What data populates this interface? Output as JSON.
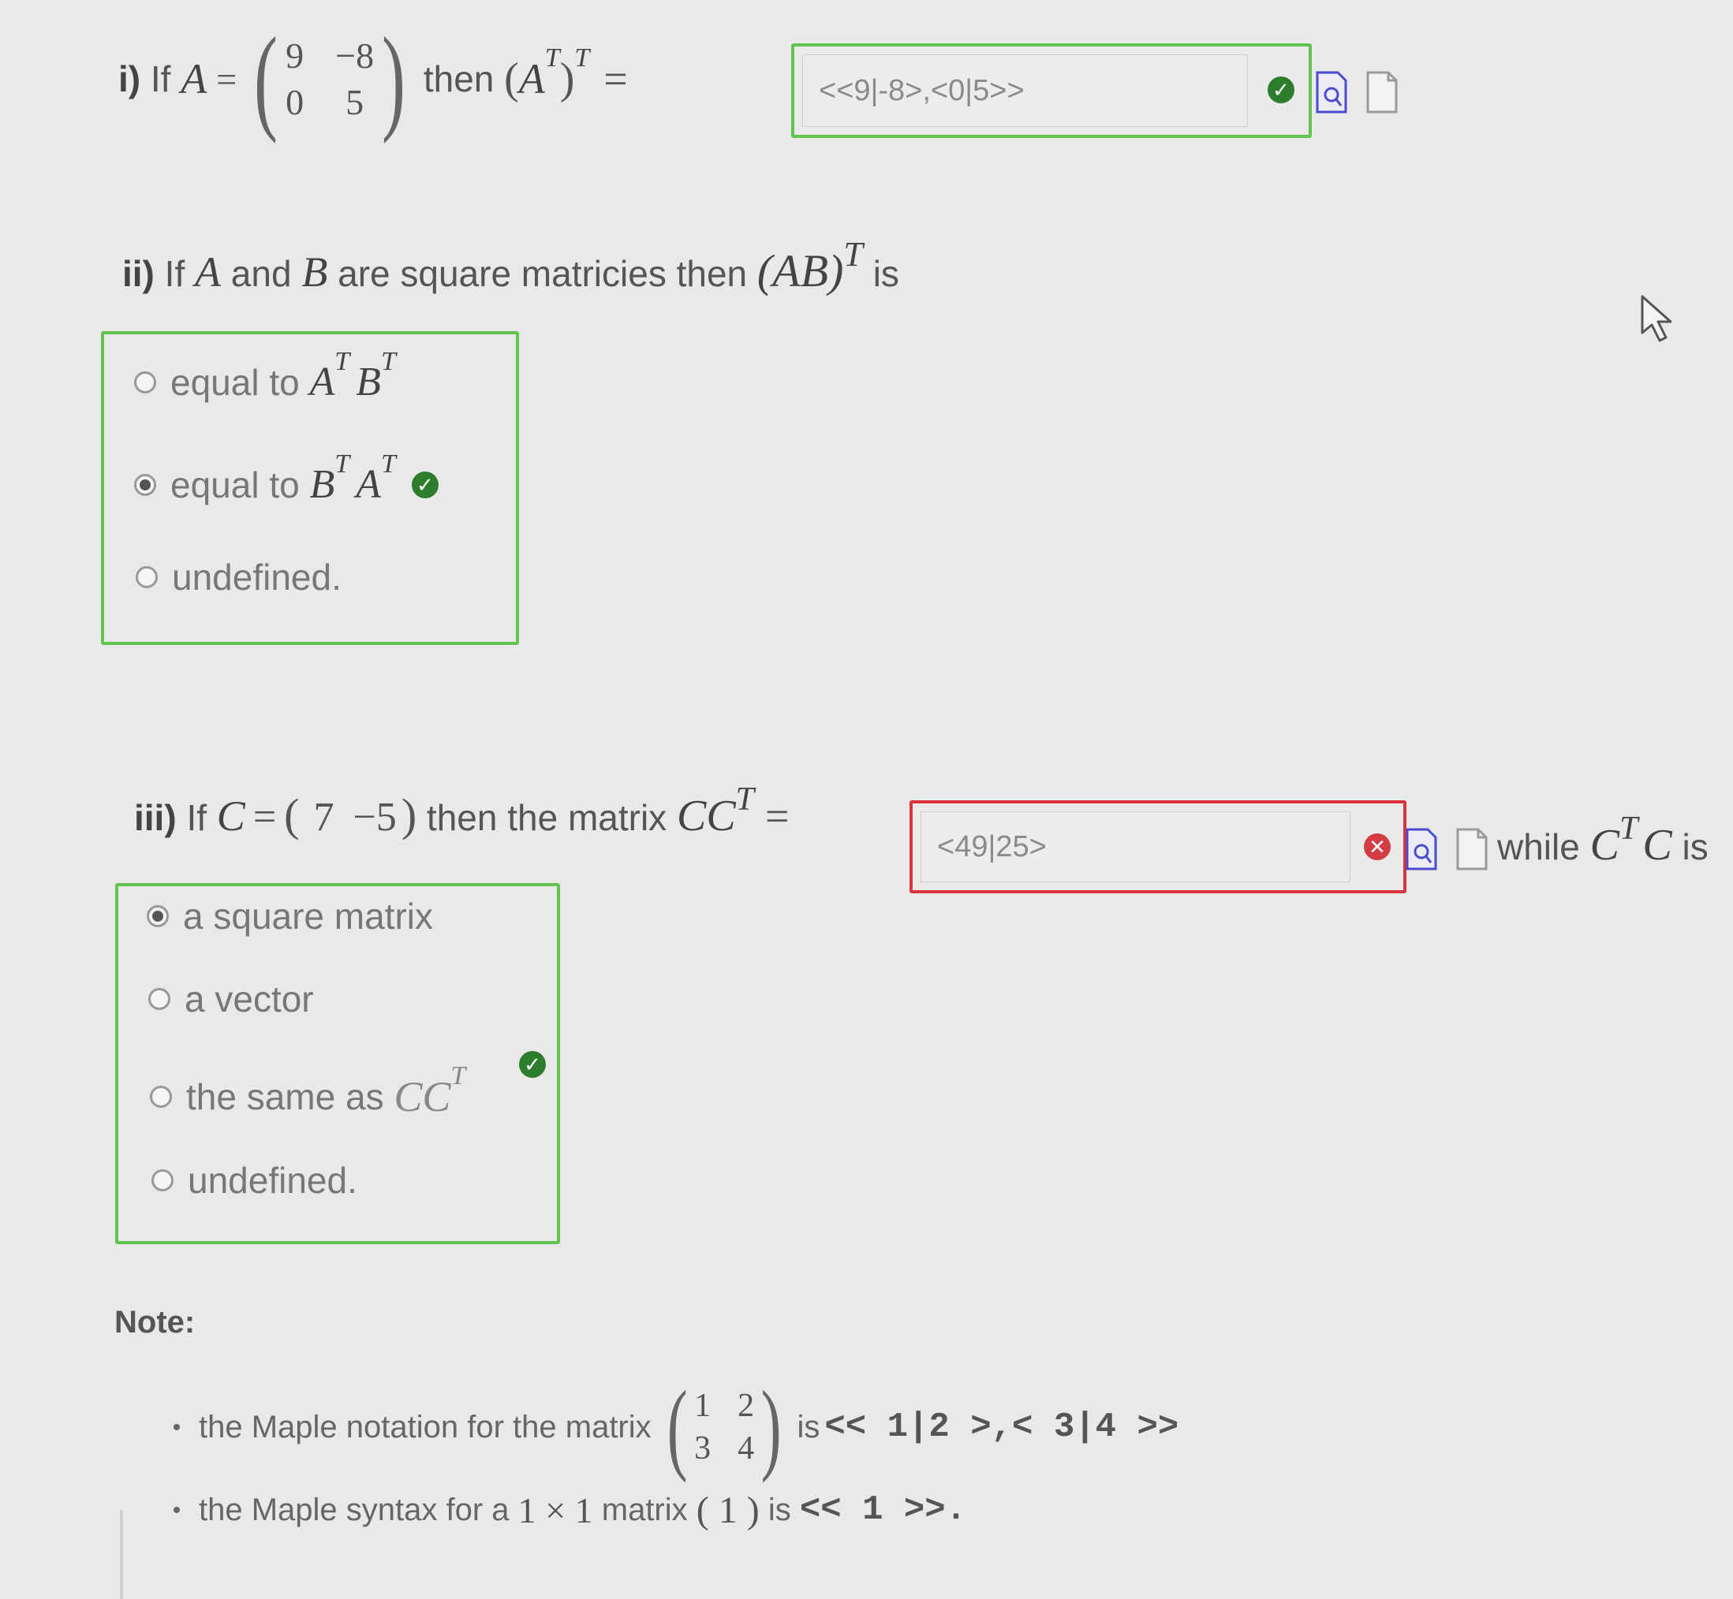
{
  "q1": {
    "label": "i)",
    "if": "If",
    "A": "A",
    "eq": "=",
    "matrix": [
      "9",
      "−8",
      "0",
      "5"
    ],
    "then": "then",
    "expr_base": "A",
    "expr_sup": "T",
    "expr_outer_sup": "T",
    "eq2": "=",
    "answer": "<<9|-8>,<0|5>>",
    "status": "correct"
  },
  "q2": {
    "label": "ii)",
    "text_if": "If",
    "A": "A",
    "and": "and",
    "B": "B",
    "rest": "are square matricies then",
    "expr": "(AB)",
    "sup": "T",
    "is": "is",
    "options": [
      {
        "text": "equal to",
        "m1": "A",
        "s1": "T",
        "m2": "B",
        "s2": "T",
        "selected": false
      },
      {
        "text": "equal to",
        "m1": "B",
        "s1": "T",
        "m2": "A",
        "s2": "T",
        "selected": true
      },
      {
        "text": "undefined.",
        "selected": false
      }
    ],
    "status": "correct"
  },
  "q3": {
    "label": "iii)",
    "if": "If",
    "C": "C",
    "eq": "=",
    "vec": [
      "7",
      "−5"
    ],
    "then": "then the matrix",
    "cc": "CC",
    "sup": "T",
    "eq2": "=",
    "answer": "<49|25>",
    "status": "incorrect",
    "while": "while",
    "ctc": "C",
    "ctc_sup": "T",
    "ctc2": "C",
    "is": "is",
    "options": [
      {
        "text": "a square matrix",
        "selected": true
      },
      {
        "text": "a vector",
        "selected": false
      },
      {
        "text": "the same as",
        "math": "CC",
        "sup": "T",
        "selected": false
      },
      {
        "text": "undefined.",
        "selected": false
      }
    ],
    "status2": "correct"
  },
  "note": {
    "title": "Note:",
    "b1_text": "the Maple notation for the matrix",
    "b1_matrix": [
      "1",
      "2",
      "3",
      "4"
    ],
    "b1_is": "is",
    "b1_code": "<< 1|2 >,< 3|4 >>",
    "b2_text": "the Maple syntax for a",
    "b2_size": "1 × 1",
    "b2_mid": "matrix",
    "b2_paren": "( 1 )",
    "b2_is": "is",
    "b2_code": "<< 1 >>."
  },
  "icons": {
    "check": "check-circle-icon",
    "error": "x-circle-icon",
    "preview": "preview-document-icon",
    "document": "document-icon",
    "cursor": "mouse-pointer-icon"
  },
  "colors": {
    "correct": "#61c451",
    "incorrect": "#d8363b",
    "check_fill": "#2c7d2c",
    "error_fill": "#d53d45"
  }
}
